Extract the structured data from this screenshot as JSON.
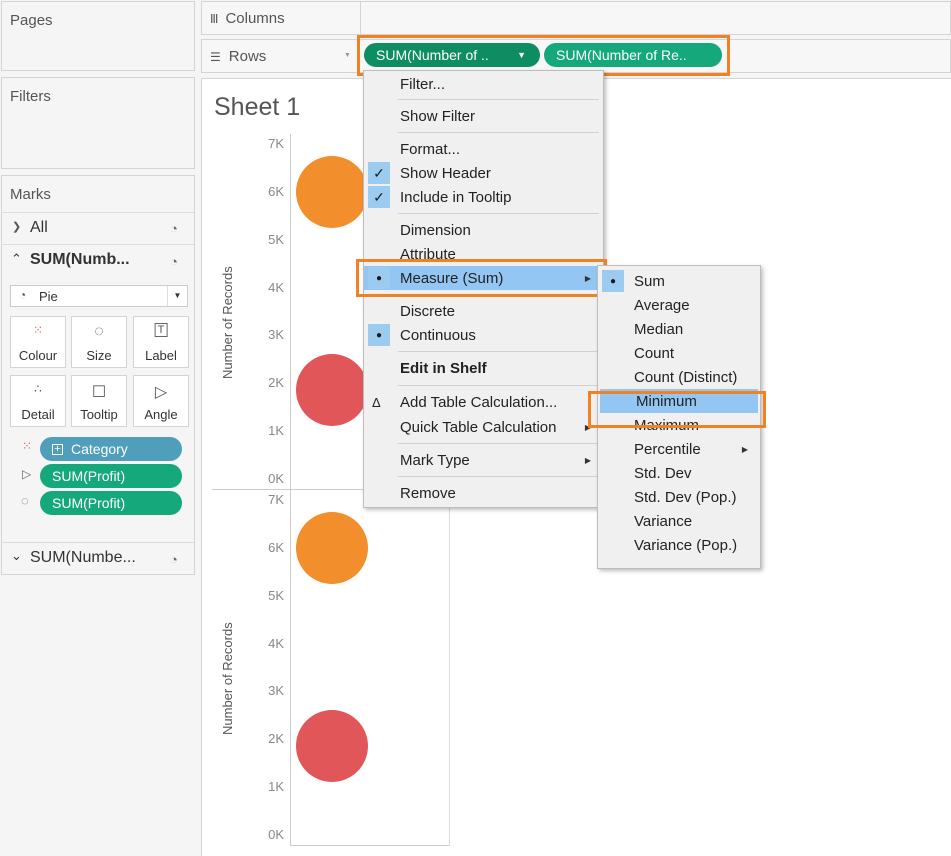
{
  "panes": {
    "pages": "Pages",
    "filters": "Filters",
    "marks": "Marks",
    "columns": "Columns",
    "rows": "Rows"
  },
  "marks": {
    "all": "All",
    "sum_layer": "SUM(Numb...",
    "sum_layer2": "SUM(Numbe...",
    "mark_type": "Pie",
    "cards": [
      "Colour",
      "Size",
      "Label",
      "Detail",
      "Tooltip",
      "Angle"
    ],
    "fields": [
      "Category",
      "SUM(Profit)",
      "SUM(Profit)"
    ]
  },
  "rows_pills": [
    "SUM(Number of ..",
    "SUM(Number of Re.."
  ],
  "sheet_title": "Sheet 1",
  "context_menu": {
    "items": [
      {
        "label": "Filter...",
        "checked": false
      },
      {
        "label": "Show Filter",
        "checked": false
      },
      {
        "label": "Format...",
        "checked": false
      },
      {
        "label": "Show Header",
        "checked": true
      },
      {
        "label": "Include in Tooltip",
        "checked": true
      },
      {
        "label": "Dimension",
        "checked": false
      },
      {
        "label": "Attribute",
        "checked": false
      },
      {
        "label": "Measure (Sum)",
        "checked": true
      },
      {
        "label": "Discrete",
        "checked": false
      },
      {
        "label": "Continuous",
        "checked": true
      },
      {
        "label": "Edit in Shelf",
        "checked": false
      },
      {
        "label": "Add Table Calculation...",
        "checked": false
      },
      {
        "label": "Quick Table Calculation",
        "checked": false
      },
      {
        "label": "Mark Type",
        "checked": false
      },
      {
        "label": "Remove",
        "checked": false
      }
    ]
  },
  "submenu": {
    "items": [
      "Sum",
      "Average",
      "Median",
      "Count",
      "Count (Distinct)",
      "Minimum",
      "Maximum",
      "Percentile",
      "Std. Dev",
      "Std. Dev (Pop.)",
      "Variance",
      "Variance (Pop.)"
    ],
    "selected": "Sum",
    "highlighted": "Minimum"
  },
  "chart_data": [
    {
      "type": "scatter",
      "ylabel": "Number of Records",
      "ylim": [
        0,
        7000
      ],
      "ticks": [
        "7K",
        "6K",
        "5K",
        "4K",
        "3K",
        "2K",
        "1K",
        "0K"
      ],
      "points": [
        {
          "y": 6000,
          "color": "#f28e2b"
        },
        {
          "y": 1850,
          "color": "#e15759"
        }
      ]
    },
    {
      "type": "scatter",
      "ylabel": "Number of Records",
      "ylim": [
        0,
        7000
      ],
      "ticks": [
        "7K",
        "6K",
        "5K",
        "4K",
        "3K",
        "2K",
        "1K",
        "0K"
      ],
      "points": [
        {
          "y": 6000,
          "color": "#f28e2b"
        },
        {
          "y": 1850,
          "color": "#e15759"
        }
      ]
    }
  ],
  "colors": {
    "highlight_border": "#f08224",
    "menu_highlight": "#93c6f3",
    "pill_green": "#15a87a",
    "pill_blue": "#4f9ebb"
  }
}
